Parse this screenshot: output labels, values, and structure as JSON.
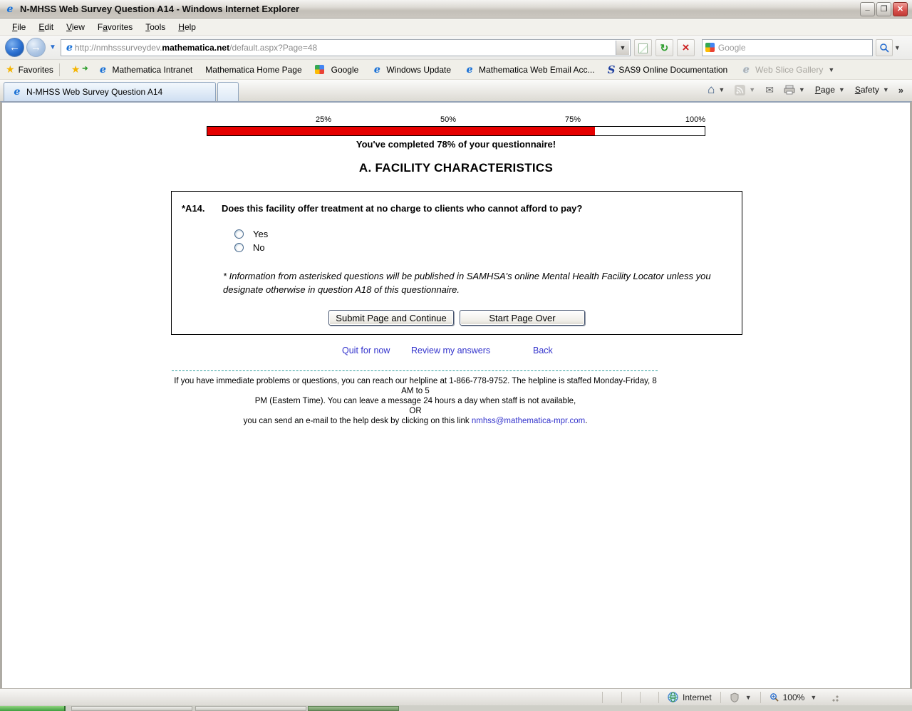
{
  "window": {
    "title": "N-MHSS Web Survey Question A14 - Windows Internet Explorer"
  },
  "menu": {
    "items": [
      {
        "label": "File",
        "u": 0
      },
      {
        "label": "Edit",
        "u": 0
      },
      {
        "label": "View",
        "u": 0
      },
      {
        "label": "Favorites",
        "u": 1
      },
      {
        "label": "Tools",
        "u": 0
      },
      {
        "label": "Help",
        "u": 0
      }
    ]
  },
  "address": {
    "url_prefix": "http://nmhsssurveydev.",
    "url_bold": "mathematica.net",
    "url_suffix": "/default.aspx?Page=48",
    "search_placeholder": "Google"
  },
  "favorites": {
    "label": "Favorites",
    "items": [
      {
        "icon": "ie",
        "label": "Mathematica Intranet"
      },
      {
        "icon": "none",
        "label": "Mathematica Home Page"
      },
      {
        "icon": "google",
        "label": "Google"
      },
      {
        "icon": "ie",
        "label": "Windows Update"
      },
      {
        "icon": "ie",
        "label": "Mathematica Web Email Acc..."
      },
      {
        "icon": "sas",
        "label": "SAS9 Online Documentation"
      },
      {
        "icon": "ie",
        "label": "Web Slice Gallery",
        "grayed": true,
        "dropdown": true
      }
    ]
  },
  "tabs": {
    "active_title": "N-MHSS Web Survey Question A14"
  },
  "command_bar": {
    "page": {
      "label": "Page",
      "u": 0
    },
    "safety": {
      "label": "Safety",
      "u": 0
    }
  },
  "survey": {
    "progress": {
      "ticks": [
        "25%",
        "50%",
        "75%",
        "100%"
      ],
      "percent": 78,
      "message": "You've completed 78% of your questionnaire!"
    },
    "section_title": "A. FACILITY CHARACTERISTICS",
    "question": {
      "number": "*A14.",
      "text": "Does this facility offer treatment at no charge to clients who cannot afford to pay?",
      "options": [
        "Yes",
        "No"
      ]
    },
    "footnote": "* Information from asterisked questions will be published in SAMHSA's online Mental Health Facility Locator unless you designate otherwise in question A18 of this questionnaire.",
    "buttons": {
      "submit": "Submit Page and Continue",
      "start_over": "Start Page Over"
    },
    "links": {
      "quit": "Quit for now",
      "review": "Review my answers",
      "back": "Back"
    },
    "help": {
      "line1": "If you have immediate problems or questions, you can reach our helpline at 1-866-778-9752. The helpline is staffed Monday-Friday, 8 AM to 5",
      "line2": "PM (Eastern Time). You can leave a message 24 hours a day when staff is not available,",
      "line3": "OR",
      "line4_prefix": "you can send an e-mail to the help desk by clicking on this link ",
      "email": "nmhss@mathematica-mpr.com",
      "line4_suffix": "."
    }
  },
  "status_bar": {
    "zone": "Internet",
    "zoom": "100%"
  },
  "colors": {
    "progress_red": "#e60000",
    "link_blue": "#3333cc",
    "dashed_teal": "#2f9e9e"
  }
}
